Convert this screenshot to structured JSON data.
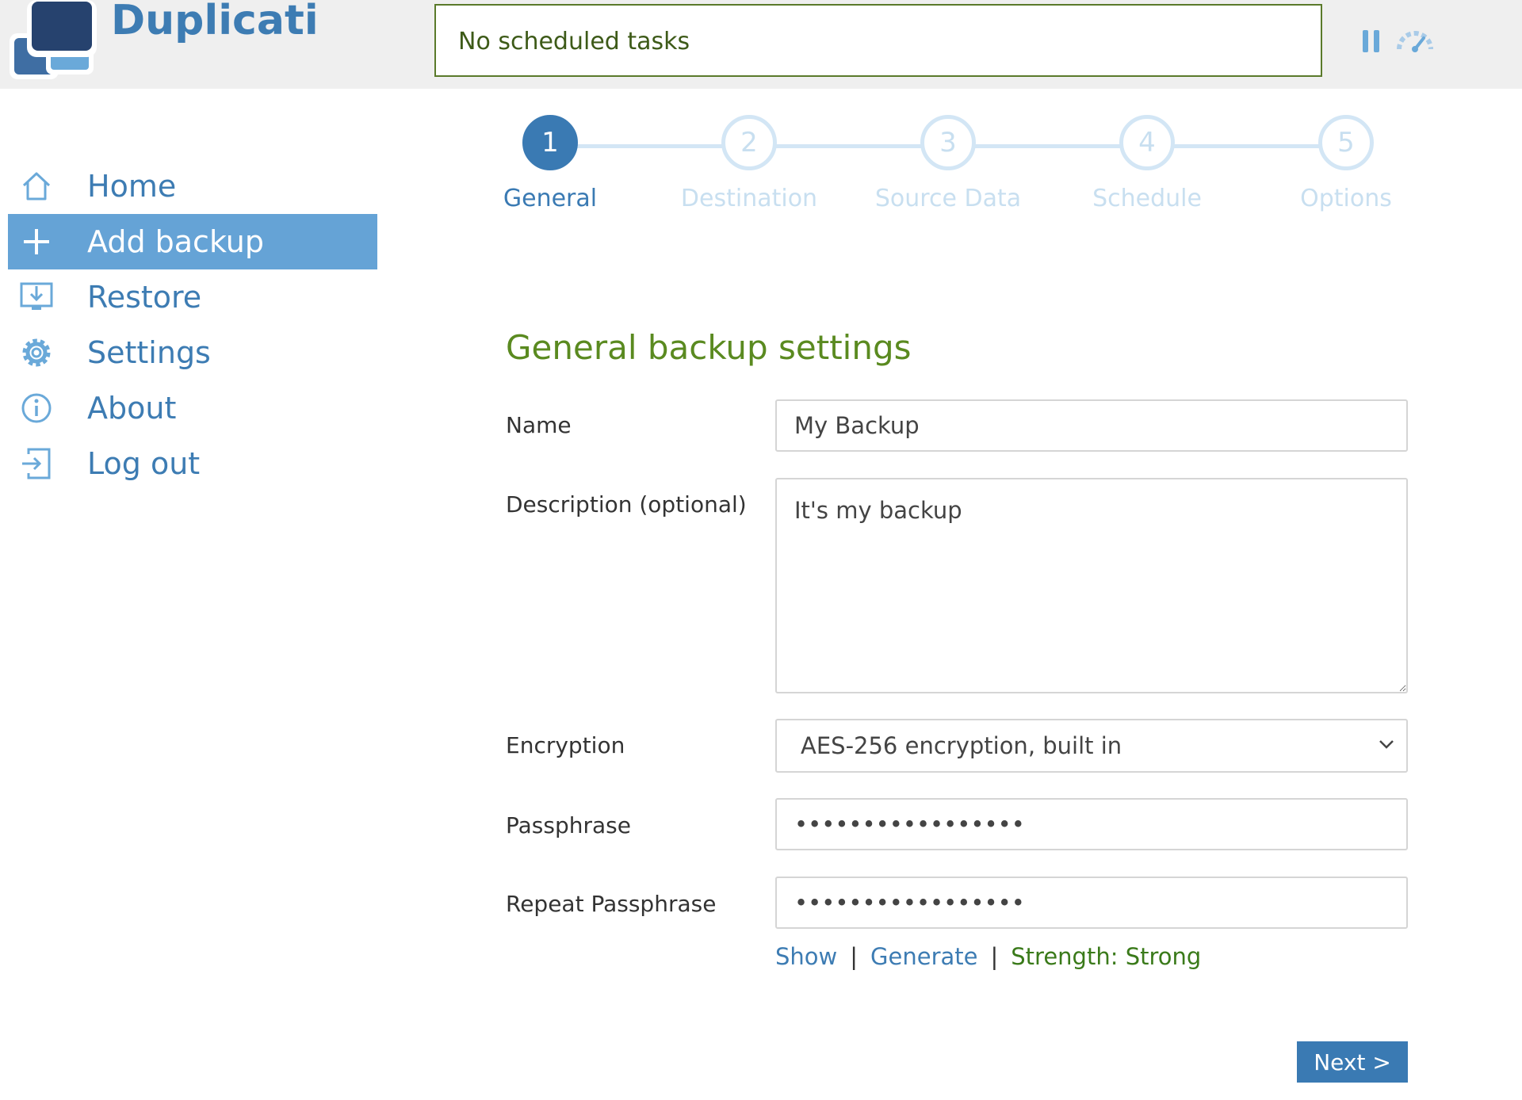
{
  "app": {
    "brand": "Duplicati"
  },
  "header": {
    "status_text": "No scheduled tasks"
  },
  "sidebar": {
    "items": [
      {
        "label": "Home",
        "icon": "home-icon",
        "active": false
      },
      {
        "label": "Add backup",
        "icon": "plus-icon",
        "active": true
      },
      {
        "label": "Restore",
        "icon": "restore-icon",
        "active": false
      },
      {
        "label": "Settings",
        "icon": "gear-icon",
        "active": false
      },
      {
        "label": "About",
        "icon": "info-icon",
        "active": false
      },
      {
        "label": "Log out",
        "icon": "logout-icon",
        "active": false
      }
    ]
  },
  "wizard": {
    "current_step": 1,
    "steps": [
      {
        "number": "1",
        "label": "General"
      },
      {
        "number": "2",
        "label": "Destination"
      },
      {
        "number": "3",
        "label": "Source Data"
      },
      {
        "number": "4",
        "label": "Schedule"
      },
      {
        "number": "5",
        "label": "Options"
      }
    ]
  },
  "form": {
    "title": "General backup settings",
    "name_label": "Name",
    "name_value": "My Backup",
    "description_label": "Description (optional)",
    "description_value": "It's my backup",
    "encryption_label": "Encryption",
    "encryption_value": "AES-256 encryption, built in",
    "passphrase_label": "Passphrase",
    "passphrase_value": "•••••••••••••••••",
    "repeat_label": "Repeat Passphrase",
    "repeat_value": "•••••••••••••••••",
    "show_link": "Show",
    "generate_link": "Generate",
    "separator": "|",
    "strength_text": "Strength: Strong"
  },
  "footer": {
    "next_label": "Next >"
  },
  "colors": {
    "accent": "#3d7cb3",
    "active_nav": "#65a3d6",
    "title_green": "#5a8a20",
    "strength_green": "#3a7a1a"
  }
}
